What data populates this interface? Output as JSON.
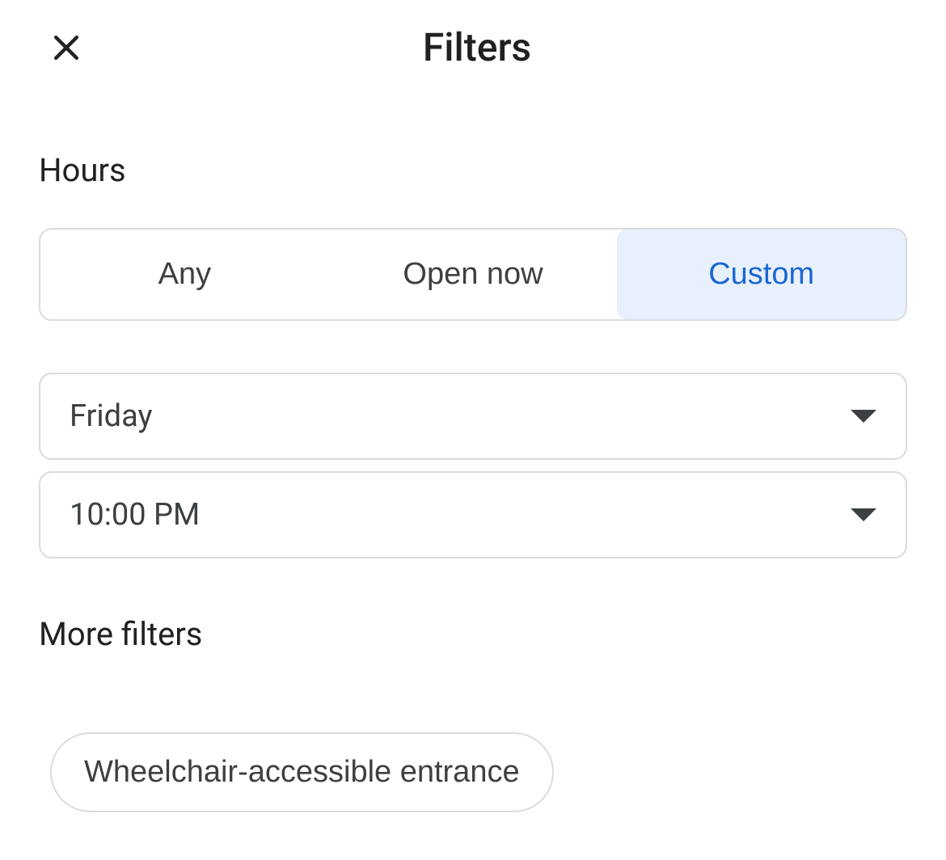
{
  "header": {
    "title": "Filters"
  },
  "hours": {
    "heading": "Hours",
    "segments": {
      "any": "Any",
      "open_now": "Open now",
      "custom": "Custom"
    },
    "day_selected": "Friday",
    "time_selected": "10:00 PM"
  },
  "more_filters": {
    "heading": "More filters",
    "chips": {
      "wheelchair": "Wheelchair-accessible entrance"
    }
  }
}
